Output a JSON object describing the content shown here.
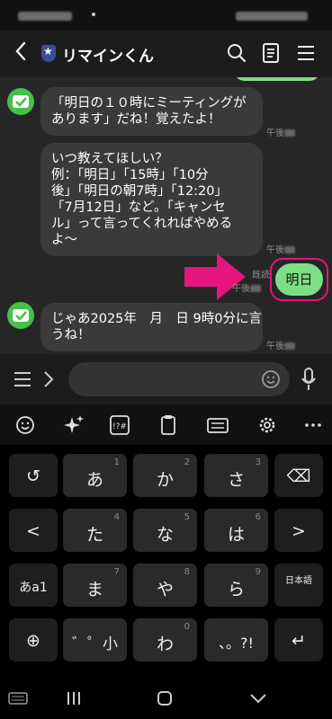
{
  "app": {
    "title": "リマインくん"
  },
  "header": {
    "back_icon": "chevron-left-icon",
    "account_icon": "shield-star-icon",
    "search_icon": "search-icon",
    "notes_icon": "note-icon",
    "menu_icon": "menu-icon"
  },
  "messages": [
    {
      "sender": "bot",
      "lines": [
        "「明日の１０時にミーティングが",
        "あります」だね！覚えたよ！"
      ],
      "time": "午後"
    },
    {
      "sender": "bot",
      "lines": [
        "いつ教えてほしい？",
        "例：「明日」「15時」「10分",
        "後」「明日の朝7時」「12:20」",
        "「7月12日」など。「キャンセ",
        "ル」って言ってくれればやめる",
        "よ〜"
      ],
      "time": "午後"
    },
    {
      "sender": "user",
      "text": "明日",
      "read": "既読",
      "time": "午後"
    },
    {
      "sender": "bot",
      "lines": [
        "じゃあ2025年　月　日 9時0分に言",
        "うね！"
      ],
      "time": "午後"
    }
  ],
  "colors": {
    "bot_avatar": "#45c049",
    "user_bubble": "#7ede86",
    "highlight": "#e4157d"
  },
  "keyboard": {
    "toolbar": [
      "emoji-icon",
      "ai-sparkle-icon",
      "symbols-icon",
      "clipboard-icon",
      "keyboard-mode-icon",
      "settings-icon",
      "more-icon"
    ],
    "row1": [
      {
        "label": "↺",
        "sub": ""
      },
      {
        "label": "あ",
        "sub": "1"
      },
      {
        "label": "か",
        "sub": "2"
      },
      {
        "label": "さ",
        "sub": "3"
      },
      {
        "label": "⌫",
        "sub": ""
      }
    ],
    "row2": [
      {
        "label": "<",
        "sub": ""
      },
      {
        "label": "た",
        "sub": "4"
      },
      {
        "label": "な",
        "sub": "5"
      },
      {
        "label": "は",
        "sub": "6"
      },
      {
        "label": ">",
        "sub": ""
      }
    ],
    "row3": [
      {
        "label": "あa1",
        "sub": ""
      },
      {
        "label": "ま",
        "sub": "7"
      },
      {
        "label": "や",
        "sub": "8"
      },
      {
        "label": "ら",
        "sub": "9"
      },
      {
        "label": "日本語",
        "sub": ""
      }
    ],
    "row4": [
      {
        "label": "⊕",
        "sub": ""
      },
      {
        "label": "゛゜小",
        "sub": ""
      },
      {
        "label": "わ",
        "sub": "0"
      },
      {
        "label": "、。?!",
        "sub": ""
      },
      {
        "label": "↵",
        "sub": ""
      }
    ]
  }
}
